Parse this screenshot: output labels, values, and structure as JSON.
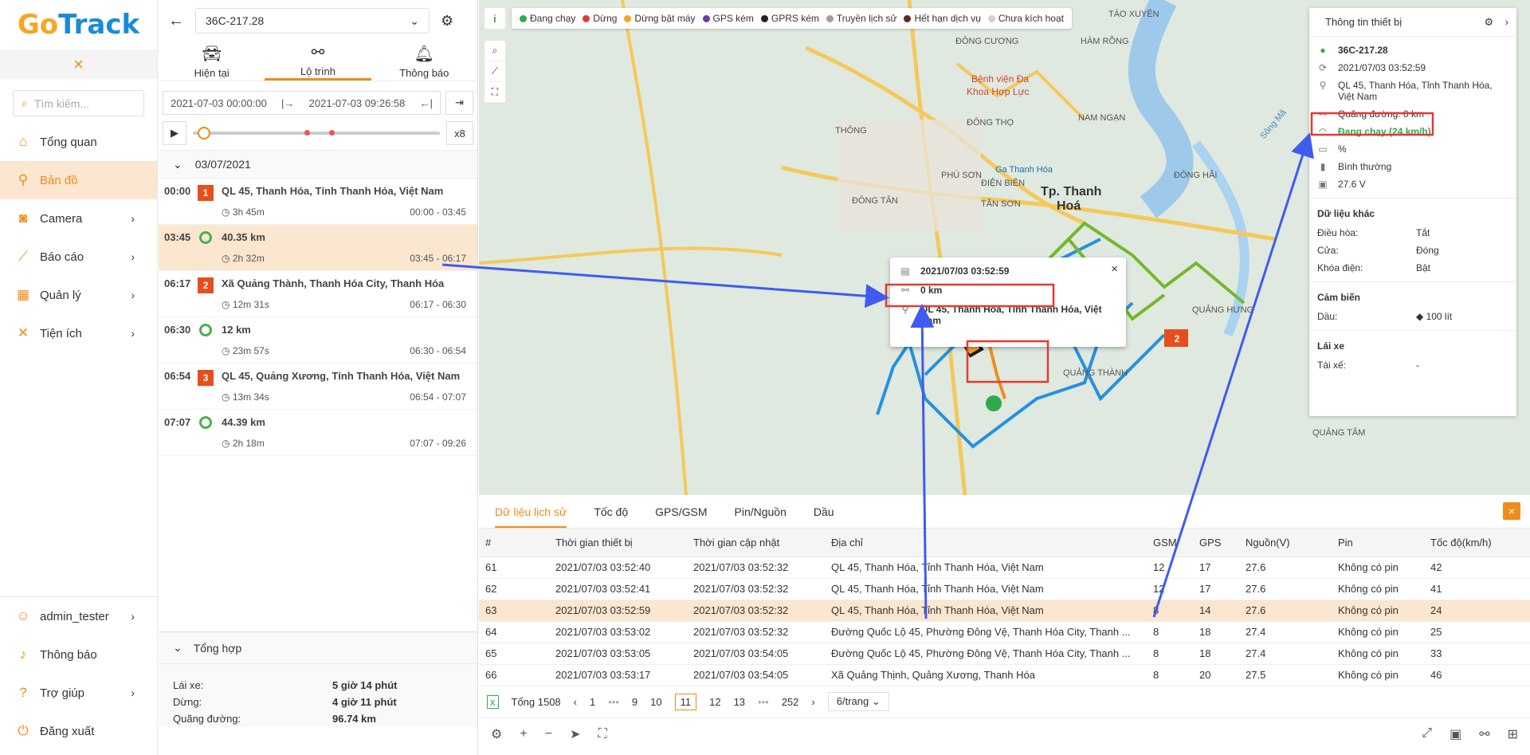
{
  "logo": {
    "go": "Go",
    "track": "Track"
  },
  "nav": {
    "collapse_icon": "×",
    "search_placeholder": "Tìm kiếm...",
    "items": [
      {
        "label": "Tổng quan",
        "icon": "home-icon"
      },
      {
        "label": "Bản đồ",
        "icon": "map-icon"
      },
      {
        "label": "Camera",
        "icon": "camera-icon"
      },
      {
        "label": "Báo cáo",
        "icon": "chart-icon"
      },
      {
        "label": "Quản lý",
        "icon": "grid-icon"
      },
      {
        "label": "Tiện ích",
        "icon": "tools-icon"
      }
    ],
    "bottom": [
      {
        "label": "admin_tester",
        "icon": "user-icon"
      },
      {
        "label": "Thông báo",
        "icon": "bell-icon"
      },
      {
        "label": "Trợ giúp",
        "icon": "help-icon"
      },
      {
        "label": "Đăng xuất",
        "icon": "logout-icon"
      }
    ]
  },
  "panel": {
    "plate": "36C-217.28",
    "tabs": [
      "Hiện tại",
      "Lộ trình",
      "Thông báo"
    ],
    "date_from": "2021-07-03 00:00:00",
    "date_to": "2021-07-03 09:26:58",
    "speed": "x8",
    "day": "03/07/2021",
    "trips": [
      {
        "time": "00:00",
        "marker": "1",
        "type": "stop",
        "title": "QL 45, Thanh Hóa, Tỉnh Thanh Hóa, Việt Nam",
        "dur": "3h 45m",
        "span": "00:00 - 03:45"
      },
      {
        "time": "03:45",
        "marker": "",
        "type": "move",
        "title": "40.35 km",
        "dur": "2h 32m",
        "span": "03:45 - 06:17"
      },
      {
        "time": "06:17",
        "marker": "2",
        "type": "stop",
        "title": "Xã Quảng Thành, Thanh Hóa City, Thanh Hóa",
        "dur": "12m 31s",
        "span": "06:17 - 06:30"
      },
      {
        "time": "06:30",
        "marker": "",
        "type": "move",
        "title": "12 km",
        "dur": "23m 57s",
        "span": "06:30 - 06:54"
      },
      {
        "time": "06:54",
        "marker": "3",
        "type": "stop",
        "title": "QL 45, Quảng Xương, Tỉnh Thanh Hóa, Việt Nam",
        "dur": "13m 34s",
        "span": "06:54 - 07:07"
      },
      {
        "time": "07:07",
        "marker": "",
        "type": "move",
        "title": "44.39 km",
        "dur": "2h 18m",
        "span": "07:07 - 09:26"
      }
    ],
    "summary": {
      "title": "Tổng hợp",
      "rows": [
        {
          "k": "Lái xe:",
          "v": "5 giờ 14 phút"
        },
        {
          "k": "Dừng:",
          "v": "4 giờ 11 phút"
        },
        {
          "k": "Quãng đường:",
          "v": "96.74 km"
        }
      ]
    }
  },
  "legend": [
    {
      "label": "Đang chạy",
      "color": "#2eaa4a"
    },
    {
      "label": "Dừng",
      "color": "#e53935"
    },
    {
      "label": "Dừng bật máy",
      "color": "#f5a623"
    },
    {
      "label": "GPS kém",
      "color": "#6a3fa0"
    },
    {
      "label": "GPRS kém",
      "color": "#222222"
    },
    {
      "label": "Truyền lịch sử",
      "color": "#9e9e9e"
    },
    {
      "label": "Hết hạn dịch vụ",
      "color": "#5a2d1a"
    },
    {
      "label": "Chưa kích hoạt",
      "color": "#d0d0d0"
    }
  ],
  "map_labels": [
    {
      "t": "TÀO XUYÊN"
    },
    {
      "t": "ĐÔNG CƯƠNG"
    },
    {
      "t": "HÀM RỒNG"
    },
    {
      "t": "Bệnh viện Đa"
    },
    {
      "t": "Khoa Hợp Lực"
    },
    {
      "t": "ĐÔNG THỌ"
    },
    {
      "t": "NAM NGẠN"
    },
    {
      "t": "THÔNG"
    },
    {
      "t": "Ga Thanh Hóa"
    },
    {
      "t": "PHÚ SƠN"
    },
    {
      "t": "ĐIỆN BIÊN"
    },
    {
      "t": "ĐÔNG HẢI"
    },
    {
      "t": "TÂN SƠN"
    },
    {
      "t": "Tp. Thanh"
    },
    {
      "t": "Hoá"
    },
    {
      "t": "ĐÔNG TÂN"
    },
    {
      "t": "QUẢNG HƯNG"
    },
    {
      "t": "QUẢNG THÀNH"
    },
    {
      "t": "QUẢNG TÂM"
    },
    {
      "t": "Sông Mã"
    }
  ],
  "popup": {
    "time": "2021/07/03 03:52:59",
    "distance": "0 km",
    "address": "QL 45, Thanh Hóa, Tỉnh Thanh Hóa, Việt Nam"
  },
  "device": {
    "title": "Thông tin thiết bị",
    "plate": "36C-217.28",
    "time": "2021/07/03 03:52:59",
    "address": "QL 45, Thanh Hóa, Tỉnh Thanh Hóa, Việt Nam",
    "distance": "Quãng đường: 0 km",
    "status": "Đang chạy  (24 km/h)",
    "battery": "%",
    "signal": "Bình thường",
    "voltage": "27.6 V",
    "other_title": "Dữ liệu khác",
    "other": [
      {
        "k": "Điều hòa:",
        "v": "Tắt"
      },
      {
        "k": "Cửa:",
        "v": "Đóng"
      },
      {
        "k": "Khóa điện:",
        "v": "Bật"
      }
    ],
    "sensor_title": "Cảm biến",
    "sensor": [
      {
        "k": "Dầu:",
        "v": "100 lít"
      }
    ],
    "driver_title": "Lái xe",
    "driver": [
      {
        "k": "Tài xế:",
        "v": "-"
      }
    ]
  },
  "bottom": {
    "tabs": [
      "Dữ liệu lịch sử",
      "Tốc độ",
      "GPS/GSM",
      "Pin/Nguồn",
      "Dầu"
    ],
    "columns": [
      "#",
      "Thời gian thiết bị",
      "Thời gian cập nhật",
      "Địa chỉ",
      "GSM",
      "GPS",
      "Nguồn(V)",
      "Pin",
      "Tốc độ(km/h)"
    ],
    "rows": [
      [
        "61",
        "2021/07/03 03:52:40",
        "2021/07/03 03:52:32",
        "QL 45, Thanh Hóa, Tỉnh Thanh Hóa, Việt Nam",
        "12",
        "17",
        "27.6",
        "Không có pin",
        "42"
      ],
      [
        "62",
        "2021/07/03 03:52:41",
        "2021/07/03 03:52:32",
        "QL 45, Thanh Hóa, Tỉnh Thanh Hóa, Việt Nam",
        "12",
        "17",
        "27.6",
        "Không có pin",
        "41"
      ],
      [
        "63",
        "2021/07/03 03:52:59",
        "2021/07/03 03:52:32",
        "QL 45, Thanh Hóa, Tỉnh Thanh Hóa, Việt Nam",
        "8",
        "14",
        "27.6",
        "Không có pin",
        "24"
      ],
      [
        "64",
        "2021/07/03 03:53:02",
        "2021/07/03 03:52:32",
        "Đường Quốc Lộ 45, Phường Đông Vệ, Thanh Hóa City, Thanh ...",
        "8",
        "18",
        "27.4",
        "Không có pin",
        "25"
      ],
      [
        "65",
        "2021/07/03 03:53:05",
        "2021/07/03 03:54:05",
        "Đường Quốc Lộ 45, Phường Đông Vệ, Thanh Hóa City, Thanh ...",
        "8",
        "18",
        "27.4",
        "Không có pin",
        "33"
      ],
      [
        "66",
        "2021/07/03 03:53:17",
        "2021/07/03 03:54:05",
        "Xã Quảng Thịnh, Quảng Xương, Thanh Hóa",
        "8",
        "20",
        "27.5",
        "Không có pin",
        "46"
      ]
    ],
    "total": "Tổng 1508",
    "pages": [
      "1",
      "•••",
      "9",
      "10",
      "11",
      "12",
      "13",
      "•••",
      "252"
    ],
    "current_page": "11",
    "per_page": "6/trang"
  }
}
